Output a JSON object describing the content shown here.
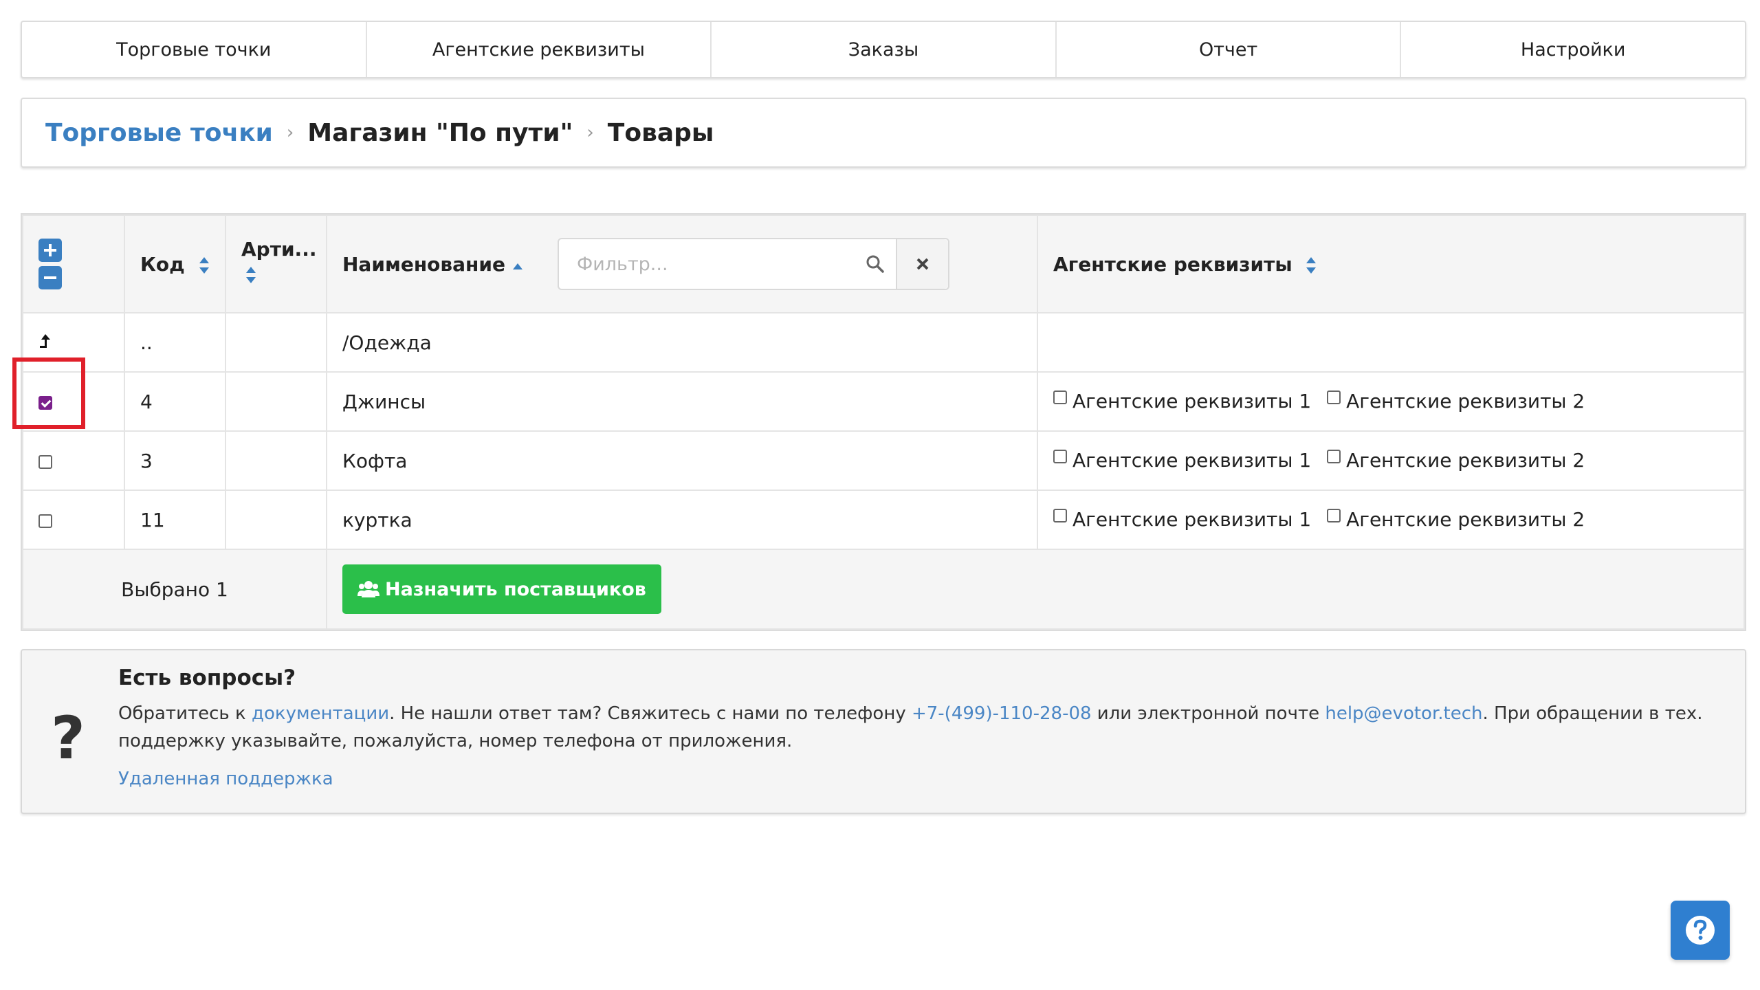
{
  "nav": {
    "items": [
      "Торговые точки",
      "Агентские реквизиты",
      "Заказы",
      "Отчет",
      "Настройки"
    ]
  },
  "breadcrumb": {
    "root": "Торговые точки",
    "store": "Магазин \"По пути\"",
    "current": "Товары",
    "separator": "›"
  },
  "table": {
    "headers": {
      "code": "Код",
      "article": "Арти...",
      "name": "Наименование",
      "agent": "Агентские реквизиты"
    },
    "filter": {
      "placeholder": "Фильтр...",
      "value": ""
    },
    "parent_row": {
      "code": "..",
      "name": "/Одежда"
    },
    "rows": [
      {
        "checked": true,
        "code": "4",
        "article": "",
        "name": "Джинсы",
        "agent1": "Агентские реквизиты 1",
        "agent2": "Агентские реквизиты 2"
      },
      {
        "checked": false,
        "code": "3",
        "article": "",
        "name": "Кофта",
        "agent1": "Агентские реквизиты 1",
        "agent2": "Агентские реквизиты 2"
      },
      {
        "checked": false,
        "code": "11",
        "article": "",
        "name": "куртка",
        "agent1": "Агентские реквизиты 1",
        "agent2": "Агентские реквизиты 2"
      }
    ],
    "footer": {
      "selected": "Выбрано 1",
      "assign_button": "Назначить поставщиков"
    }
  },
  "help": {
    "title": "Есть вопросы?",
    "text_1": "Обратитесь к ",
    "doc_link": "документации",
    "text_2": ". Не нашли ответ там? Свяжитесь с нами по телефону ",
    "phone": "+7-(499)-110-28-08",
    "text_3": " или электронной почте ",
    "email": "help@evotor.tech",
    "text_4": ". При обращении в тех. поддержку указывайте, пожалуйста, номер телефона от приложения.",
    "remote": "Удаленная поддержка",
    "question_mark": "?"
  },
  "colors": {
    "accent": "#3a7fc1",
    "success": "#2bbf4a",
    "checkbox_checked": "#7a1f8b",
    "highlight": "#e0202a"
  },
  "icons": [
    "plus-square-icon",
    "minus-square-icon",
    "sort-icon",
    "search-icon",
    "close-icon",
    "level-up-icon",
    "users-icon",
    "help-icon"
  ]
}
